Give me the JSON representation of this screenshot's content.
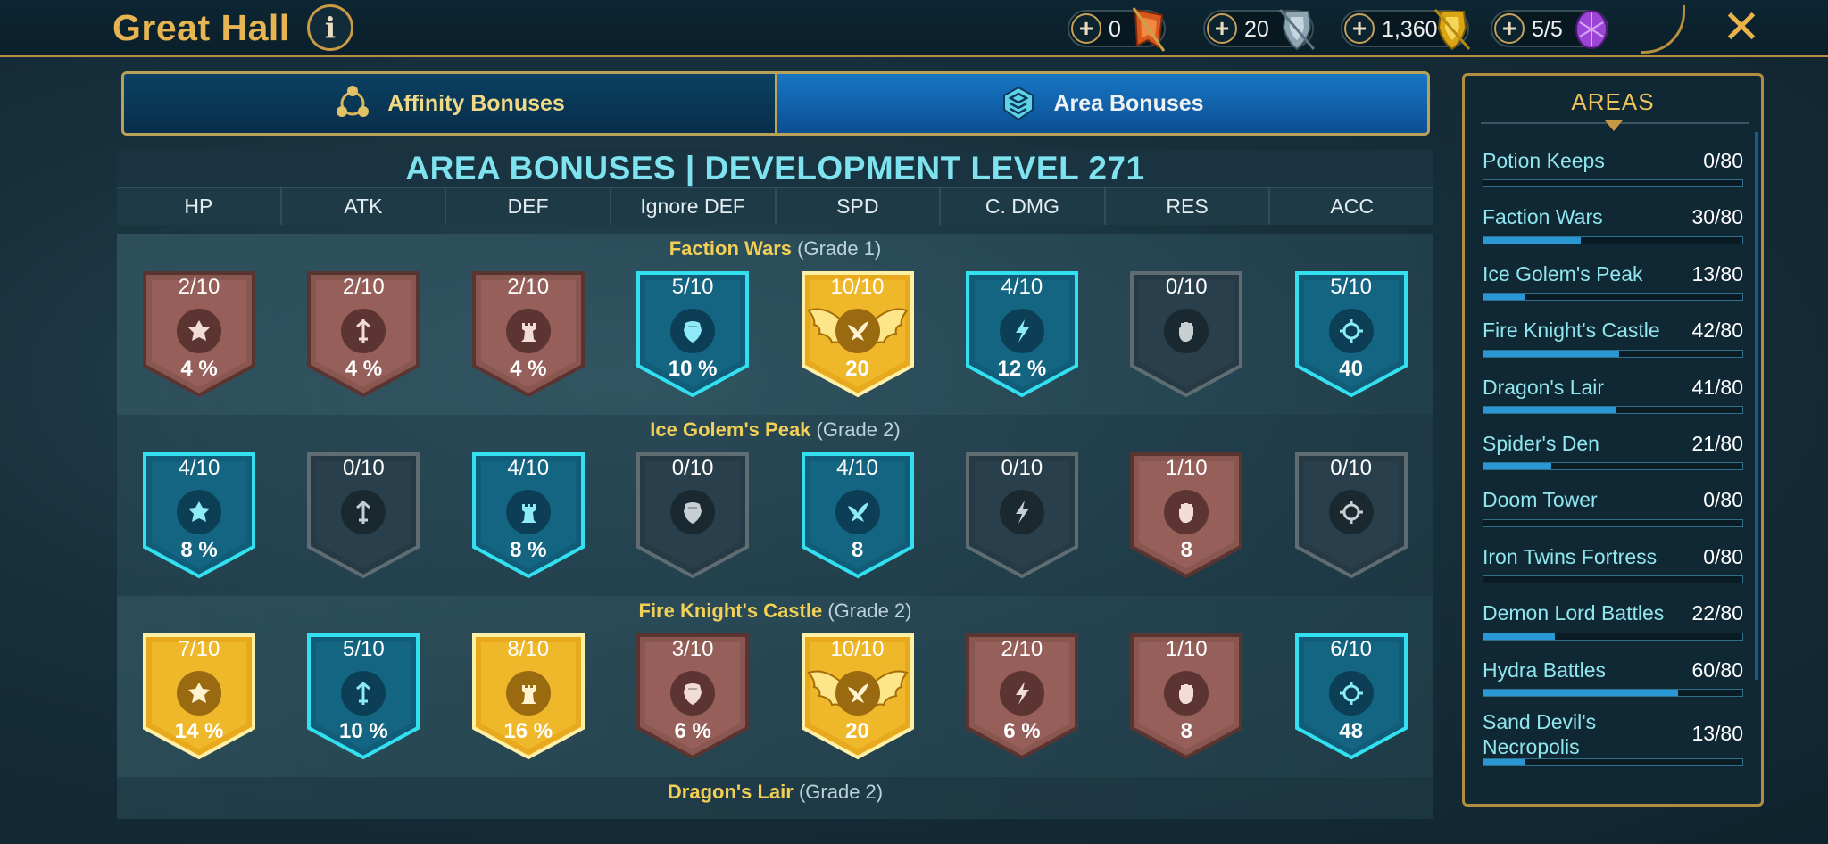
{
  "header": {
    "title": "Great Hall",
    "info_label": "i",
    "close_label": "✕",
    "resources": [
      {
        "name": "plus",
        "value": "0",
        "icon": "orange-banner-icon",
        "color": "#e0642a"
      },
      {
        "name": "plus",
        "value": "20",
        "icon": "silver-shield-icon",
        "color": "#9fb7c4"
      },
      {
        "name": "plus",
        "value": "1,360",
        "icon": "gold-shield-icon",
        "color": "#e6b320"
      },
      {
        "name": "plus",
        "value": "5/5",
        "icon": "purple-gem-icon",
        "color": "#b25be0"
      }
    ]
  },
  "tabs": [
    {
      "label": "Affinity Bonuses",
      "icon": "affinity-icon",
      "active": false
    },
    {
      "label": "Area Bonuses",
      "icon": "area-icon",
      "active": true
    }
  ],
  "main": {
    "heading": "AREA BONUSES | DEVELOPMENT LEVEL 271",
    "stats": [
      "HP",
      "ATK",
      "DEF",
      "Ignore DEF",
      "SPD",
      "C. DMG",
      "RES",
      "ACC"
    ],
    "stat_icons": [
      "hp-icon",
      "atk-icon",
      "def-icon",
      "ignore-def-icon",
      "spd-icon",
      "cdmg-icon",
      "res-icon",
      "acc-icon"
    ],
    "areas": [
      {
        "name": "Faction Wars",
        "grade": "(Grade 1)",
        "badges": [
          {
            "level": "2/10",
            "bonus": "4 %",
            "tier": "bronze"
          },
          {
            "level": "2/10",
            "bonus": "4 %",
            "tier": "bronze"
          },
          {
            "level": "2/10",
            "bonus": "4 %",
            "tier": "bronze"
          },
          {
            "level": "5/10",
            "bonus": "10 %",
            "tier": "teal"
          },
          {
            "level": "10/10",
            "bonus": "20",
            "tier": "gold",
            "winged": true
          },
          {
            "level": "4/10",
            "bonus": "12 %",
            "tier": "teal"
          },
          {
            "level": "0/10",
            "bonus": "",
            "tier": "dark"
          },
          {
            "level": "5/10",
            "bonus": "40",
            "tier": "teal"
          }
        ]
      },
      {
        "name": "Ice Golem's Peak",
        "grade": "(Grade 2)",
        "badges": [
          {
            "level": "4/10",
            "bonus": "8 %",
            "tier": "teal"
          },
          {
            "level": "0/10",
            "bonus": "",
            "tier": "dark"
          },
          {
            "level": "4/10",
            "bonus": "8 %",
            "tier": "teal"
          },
          {
            "level": "0/10",
            "bonus": "",
            "tier": "dark"
          },
          {
            "level": "4/10",
            "bonus": "8",
            "tier": "teal"
          },
          {
            "level": "0/10",
            "bonus": "",
            "tier": "dark"
          },
          {
            "level": "1/10",
            "bonus": "8",
            "tier": "bronze"
          },
          {
            "level": "0/10",
            "bonus": "",
            "tier": "dark"
          }
        ]
      },
      {
        "name": "Fire Knight's Castle",
        "grade": "(Grade 2)",
        "badges": [
          {
            "level": "7/10",
            "bonus": "14 %",
            "tier": "gold"
          },
          {
            "level": "5/10",
            "bonus": "10 %",
            "tier": "teal"
          },
          {
            "level": "8/10",
            "bonus": "16 %",
            "tier": "gold"
          },
          {
            "level": "3/10",
            "bonus": "6 %",
            "tier": "bronze"
          },
          {
            "level": "10/10",
            "bonus": "20",
            "tier": "gold",
            "winged": true
          },
          {
            "level": "2/10",
            "bonus": "6 %",
            "tier": "bronze"
          },
          {
            "level": "1/10",
            "bonus": "8",
            "tier": "bronze"
          },
          {
            "level": "6/10",
            "bonus": "48",
            "tier": "teal"
          }
        ]
      },
      {
        "name": "Dragon's Lair",
        "grade": "(Grade 2)",
        "badges": []
      }
    ]
  },
  "sidebar": {
    "title": "AREAS",
    "items": [
      {
        "name": "Potion Keeps",
        "progress": "0/80",
        "fraction": 0
      },
      {
        "name": "Faction Wars",
        "progress": "30/80",
        "fraction": 0.375
      },
      {
        "name": "Ice Golem's Peak",
        "progress": "13/80",
        "fraction": 0.1625
      },
      {
        "name": "Fire Knight's Castle",
        "progress": "42/80",
        "fraction": 0.525
      },
      {
        "name": "Dragon's Lair",
        "progress": "41/80",
        "fraction": 0.5125
      },
      {
        "name": "Spider's Den",
        "progress": "21/80",
        "fraction": 0.2625
      },
      {
        "name": "Doom Tower",
        "progress": "0/80",
        "fraction": 0
      },
      {
        "name": "Iron Twins Fortress",
        "progress": "0/80",
        "fraction": 0
      },
      {
        "name": "Demon Lord Battles",
        "progress": "22/80",
        "fraction": 0.275
      },
      {
        "name": "Hydra Battles",
        "progress": "60/80",
        "fraction": 0.75
      },
      {
        "name": "Sand Devil's Necropolis",
        "progress": "13/80",
        "fraction": 0.1625
      }
    ]
  }
}
